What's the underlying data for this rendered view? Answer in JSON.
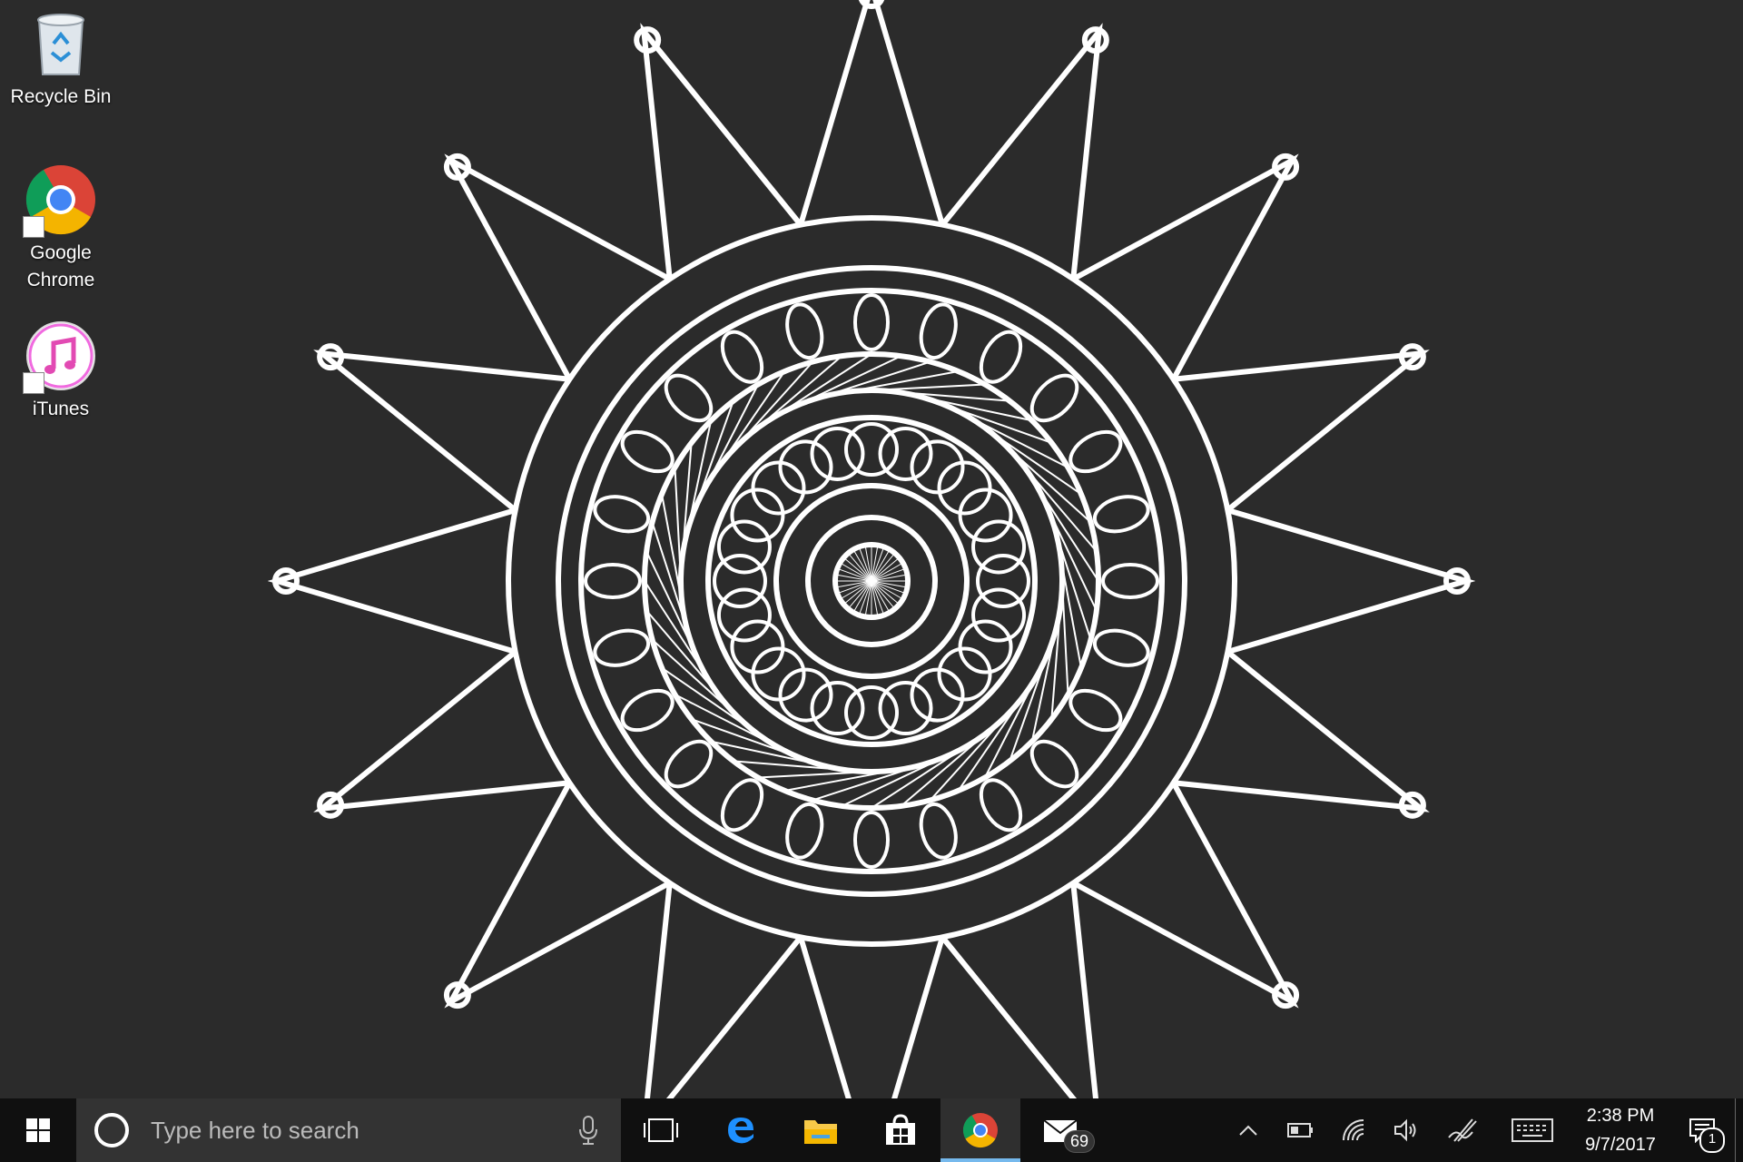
{
  "desktop": {
    "icons": [
      {
        "label": "Recycle Bin"
      },
      {
        "label": "Google\nChrome"
      },
      {
        "label": "iTunes"
      }
    ],
    "wallpaper": "mandala-drawing"
  },
  "taskbar": {
    "search_placeholder": "Type here to search",
    "apps": [
      {
        "name": "task-view",
        "icon": "task-view-icon"
      },
      {
        "name": "edge",
        "icon": "edge-icon"
      },
      {
        "name": "file-explorer",
        "icon": "folder-icon"
      },
      {
        "name": "store",
        "icon": "store-icon"
      },
      {
        "name": "chrome",
        "icon": "chrome-icon",
        "active": true
      },
      {
        "name": "mail",
        "icon": "mail-icon",
        "badge": "69"
      }
    ],
    "tray": {
      "clock_time": "2:38 PM",
      "clock_date": "9/7/2017",
      "notification_count": "1"
    }
  },
  "colors": {
    "desktop_bg": "#2b2b2b",
    "taskbar_bg": "#101010",
    "accent": "#76b9ed"
  }
}
